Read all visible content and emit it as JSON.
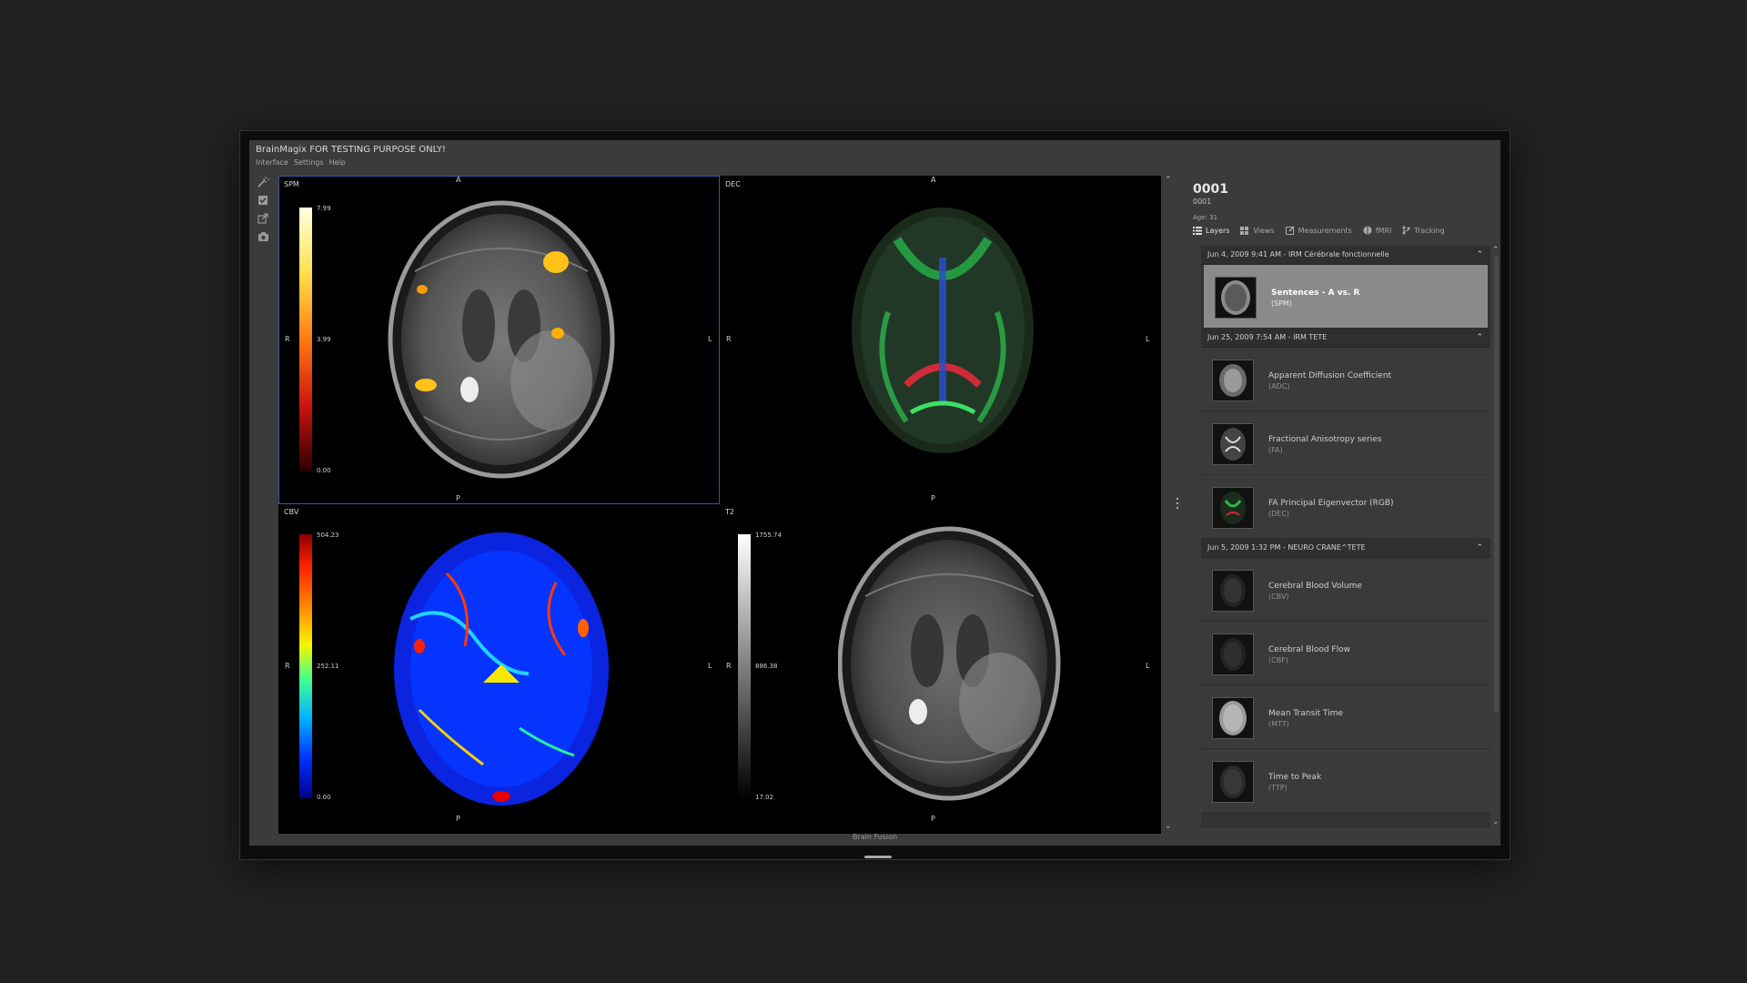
{
  "app": {
    "title": "BrainMagix FOR TESTING PURPOSE ONLY!",
    "menu": [
      "Interface",
      "Settings",
      "Help"
    ],
    "status": "Brain Fusion"
  },
  "panes": [
    {
      "label": "SPM",
      "top": "A",
      "bottom": "P",
      "left": "R",
      "right": "L",
      "scale_max": "7.99",
      "scale_mid": "3.99",
      "scale_min": "0.00"
    },
    {
      "label": "DEC",
      "top": "A",
      "bottom": "P",
      "left": "R",
      "right": "L"
    },
    {
      "label": "CBV",
      "top": "A",
      "bottom": "P",
      "left": "R",
      "right": "L",
      "scale_max": "504.23",
      "scale_mid": "252.11",
      "scale_min": "0.00"
    },
    {
      "label": "T2",
      "top": "A",
      "bottom": "P",
      "left": "R",
      "right": "L",
      "scale_max": "1755.74",
      "scale_mid": "886.38",
      "scale_min": "17.02"
    }
  ],
  "patient": {
    "name": "0001",
    "id": "0001",
    "age": "Age: 31"
  },
  "tabs": [
    "Layers",
    "Views",
    "Measurements",
    "fMRI",
    "Tracking"
  ],
  "groups": [
    {
      "header": "Jun 4, 2009 9:41 AM - IRM Cérébrale fonctionnelle",
      "items": [
        {
          "name": "Sentences - A vs. R",
          "sub": "(SPM)"
        }
      ]
    },
    {
      "header": "Jun 25, 2009 7:54 AM - IRM TETE",
      "items": [
        {
          "name": "Apparent Diffusion Coefficient",
          "sub": "(ADC)"
        },
        {
          "name": "Fractional Anisotropy series",
          "sub": "(FA)"
        },
        {
          "name": "FA Principal Eigenvector (RGB)",
          "sub": "(DEC)"
        }
      ]
    },
    {
      "header": "Jun 5, 2009 1:32 PM - NEURO CRANE^TETE",
      "items": [
        {
          "name": "Cerebral Blood Volume",
          "sub": "(CBV)"
        },
        {
          "name": "Cerebral Blood Flow",
          "sub": "(CBF)"
        },
        {
          "name": "Mean Transit Time",
          "sub": "(MTT)"
        },
        {
          "name": "Time to Peak",
          "sub": "(TTP)"
        }
      ]
    }
  ],
  "colors": {
    "selection": "#3b56a6",
    "background": "#212121",
    "panel": "#3b3b3b"
  }
}
